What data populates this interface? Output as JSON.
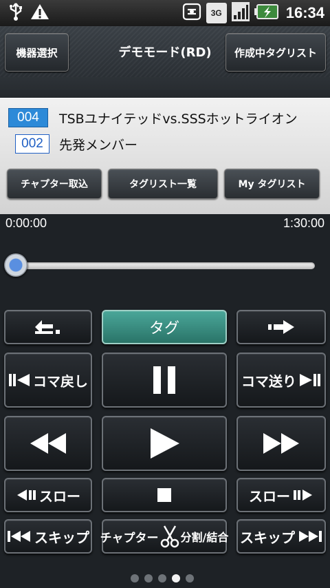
{
  "header": {
    "left_button": "機器選択",
    "title": "デモモード(RD)",
    "right_button": "作成中タグリスト"
  },
  "status_bar": {
    "network": "3G",
    "clock": "16:34"
  },
  "info": {
    "program_number": "004",
    "program_title": "TSBユナイテッドvs.SSSホットライオン",
    "chapter_number": "002",
    "chapter_title": "先発メンバー",
    "buttons": [
      "チャプター取込",
      "タグリスト一覧",
      "My タグリスト"
    ]
  },
  "playback": {
    "start_time": "0:00:00",
    "end_time": "1:30:00",
    "position_fraction": 0.0
  },
  "controls": {
    "tag_label": "タグ",
    "frame_back_label": "コマ戻し",
    "frame_forward_label": "コマ送り",
    "slow_back_label": "スロー",
    "slow_forward_label": "スロー",
    "skip_back_label": "スキップ",
    "skip_forward_label": "スキップ",
    "chapter_split_label_1": "チャプター",
    "chapter_split_label_2": "分割/結合"
  },
  "page_indicator": {
    "count": 5,
    "active_index": 3
  }
}
